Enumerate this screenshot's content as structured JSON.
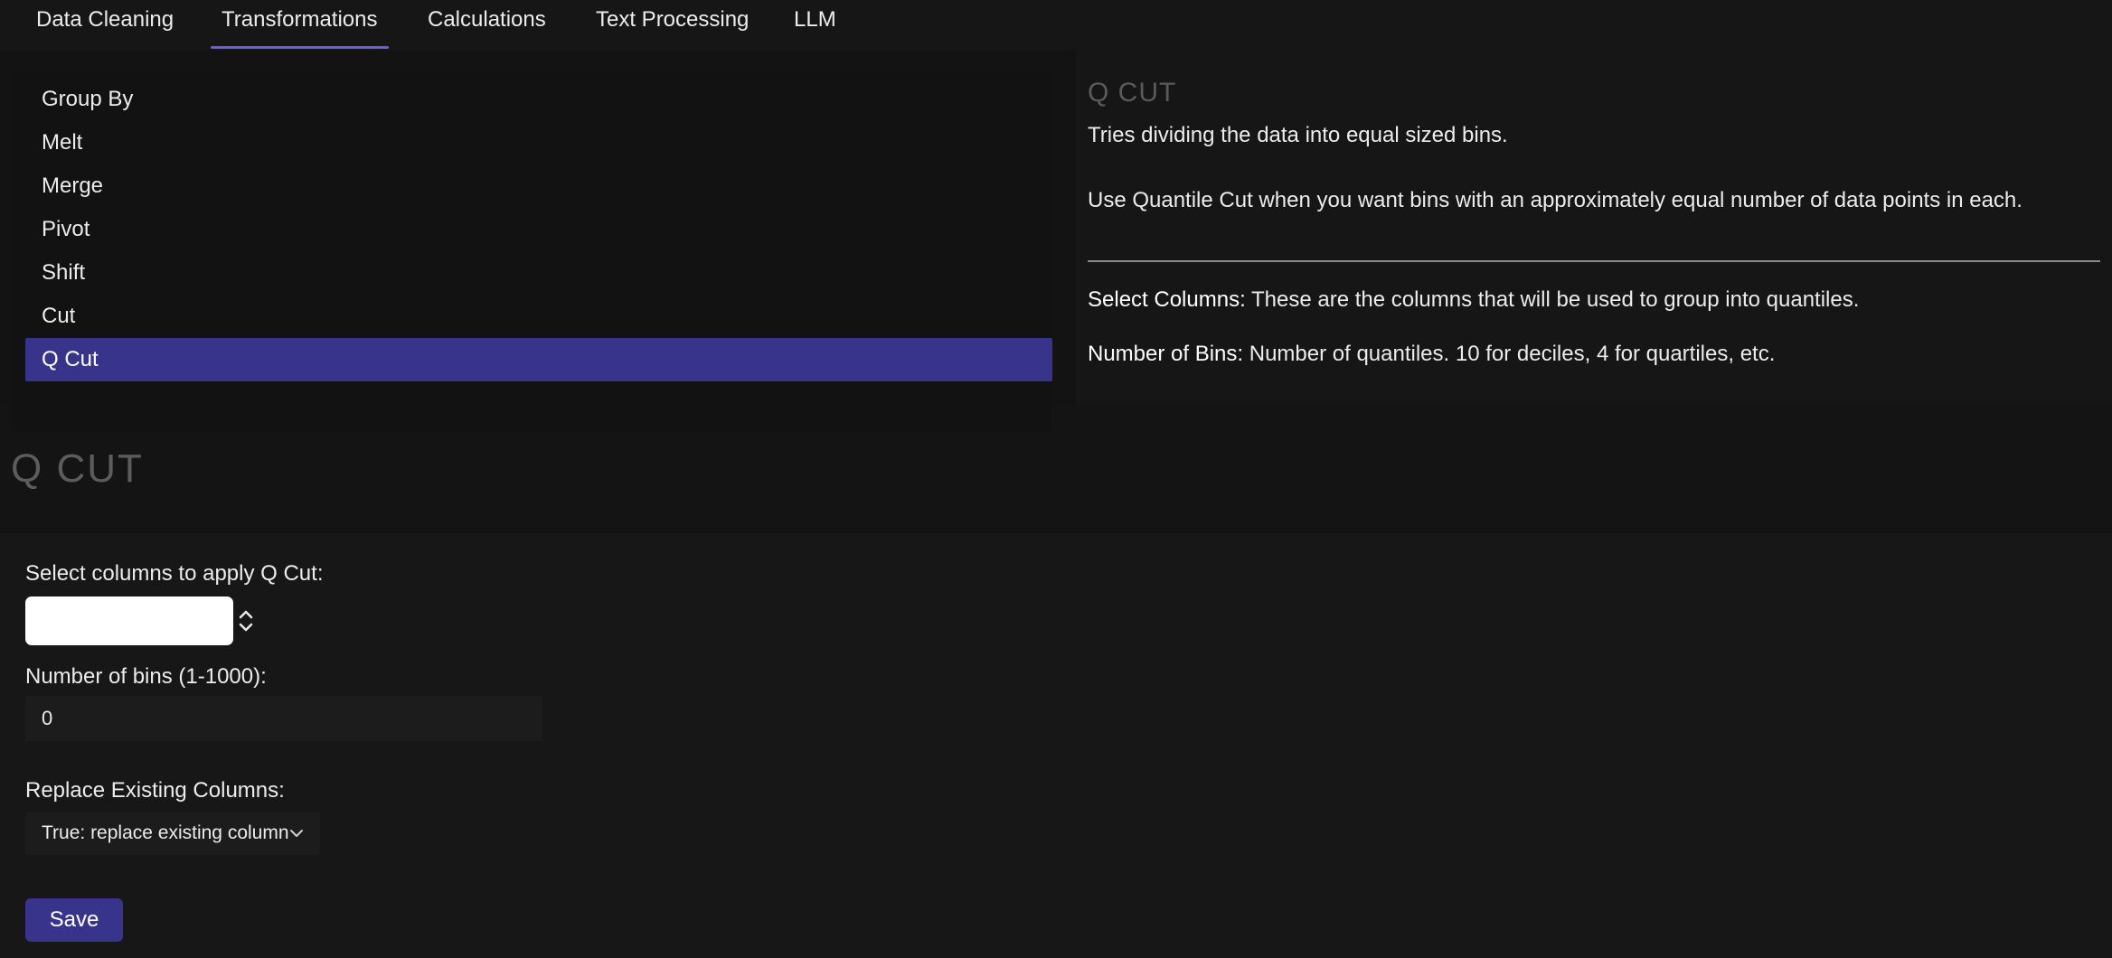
{
  "tabs": [
    {
      "label": "Data Cleaning",
      "active": false
    },
    {
      "label": "Transformations",
      "active": true
    },
    {
      "label": "Calculations",
      "active": false
    },
    {
      "label": "Text Processing",
      "active": false
    },
    {
      "label": "LLM",
      "active": false
    }
  ],
  "menu": {
    "items": [
      {
        "label": "Group By",
        "selected": false
      },
      {
        "label": "Melt",
        "selected": false
      },
      {
        "label": "Merge",
        "selected": false
      },
      {
        "label": "Pivot",
        "selected": false
      },
      {
        "label": "Shift",
        "selected": false
      },
      {
        "label": "Cut",
        "selected": false
      },
      {
        "label": "Q Cut",
        "selected": true
      }
    ]
  },
  "help": {
    "title": "Q CUT",
    "description": "Tries dividing the data into equal sized bins.",
    "usage": "Use Quantile Cut when you want bins with an approximately equal number of data points in each.",
    "params": [
      {
        "term": "Select Columns:",
        "text": "These are the columns that will be used to group into quantiles."
      },
      {
        "term": "Number of Bins:",
        "text": "Number of quantiles. 10 for deciles, 4 for quartiles, etc."
      }
    ]
  },
  "form": {
    "heading": "Q CUT",
    "columns_label": "Select columns to apply Q Cut:",
    "columns_value": "",
    "bins_label": "Number of bins (1-1000):",
    "bins_value": "0",
    "replace_label": "Replace Existing Columns:",
    "replace_value": "True: replace existing column",
    "save_label": "Save"
  },
  "colors": {
    "accent": "#39348b",
    "tab_underline": "#6b5ce7",
    "background": "#141414"
  }
}
